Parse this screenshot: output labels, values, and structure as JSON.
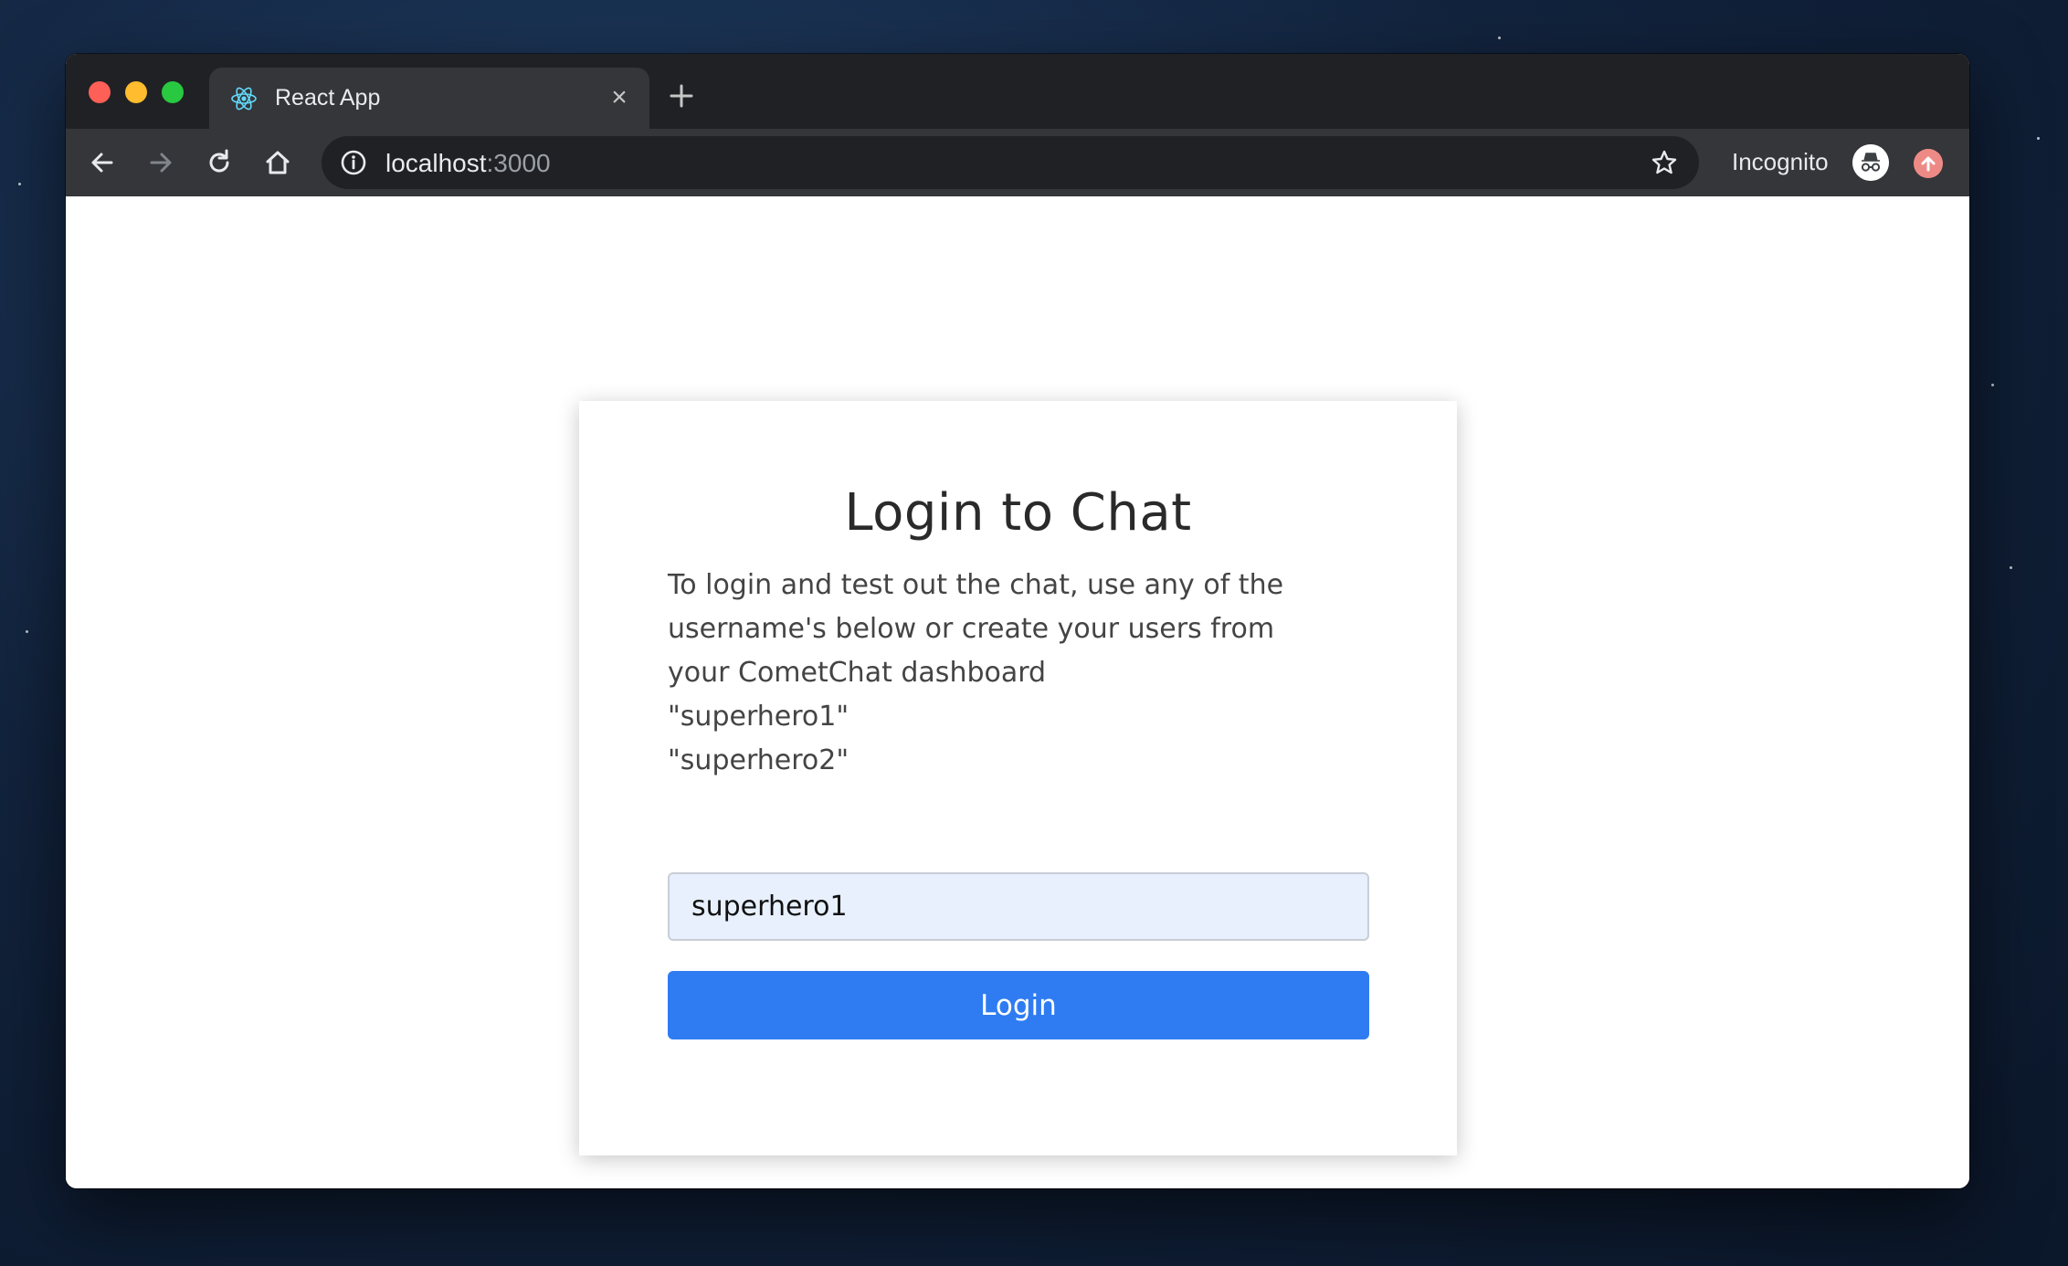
{
  "browser": {
    "tab": {
      "title": "React App",
      "favicon": "react-logo-icon",
      "close": "×"
    },
    "new_tab_icon": "plus-icon",
    "nav_icons": [
      "back-arrow-icon",
      "forward-arrow-icon",
      "reload-icon",
      "home-icon"
    ],
    "address_bar": {
      "host": "localhost",
      "port": ":3000",
      "info_icon": "info-icon",
      "bookmark_icon": "star-icon"
    },
    "profile": {
      "label": "Incognito",
      "icon": "incognito-icon",
      "update_icon": "update-arrow-icon"
    }
  },
  "page": {
    "title": "Login to Chat",
    "description": {
      "line1": "To login and test out the chat, use any of the username's below or create your users from your CometChat dashboard",
      "line2": "\"superhero1\"",
      "line3": "\"superhero2\""
    },
    "username_input": {
      "value": "superhero1"
    },
    "login_button": "Login"
  },
  "colors": {
    "button": "#2f7cf2",
    "input_bg": "#e8f0fe",
    "titlebar": "#202124",
    "toolbar": "#35363a"
  }
}
